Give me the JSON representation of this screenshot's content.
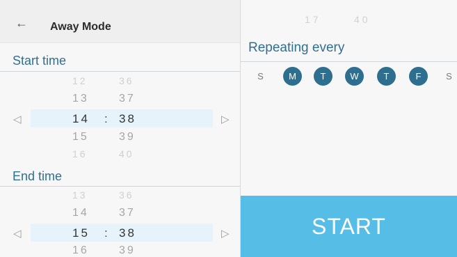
{
  "header": {
    "back_icon": "arrow-left-icon",
    "title": "Away Mode"
  },
  "start_time": {
    "label": "Start time",
    "rows": [
      {
        "h": "12",
        "m": "36"
      },
      {
        "h": "13",
        "m": "37"
      },
      {
        "h": "14",
        "m": "38"
      },
      {
        "h": "15",
        "m": "39"
      },
      {
        "h": "16",
        "m": "40"
      }
    ],
    "separator": ":"
  },
  "end_time": {
    "label": "End time",
    "rows": [
      {
        "h": "13",
        "m": "36"
      },
      {
        "h": "14",
        "m": "37"
      },
      {
        "h": "15",
        "m": "38"
      },
      {
        "h": "16",
        "m": "39"
      }
    ],
    "separator": ":"
  },
  "right_top_faded": {
    "h": "17",
    "m": "40"
  },
  "repeat": {
    "label": "Repeating every",
    "days": [
      {
        "label": "S",
        "selected": false
      },
      {
        "label": "M",
        "selected": true
      },
      {
        "label": "T",
        "selected": true
      },
      {
        "label": "W",
        "selected": true
      },
      {
        "label": "T",
        "selected": true
      },
      {
        "label": "F",
        "selected": true
      },
      {
        "label": "S",
        "selected": false
      }
    ]
  },
  "start_button": {
    "label": "START"
  },
  "colors": {
    "accent": "#56bde7",
    "day_selected": "#2e6e8f",
    "section_label": "#2f6f93"
  }
}
